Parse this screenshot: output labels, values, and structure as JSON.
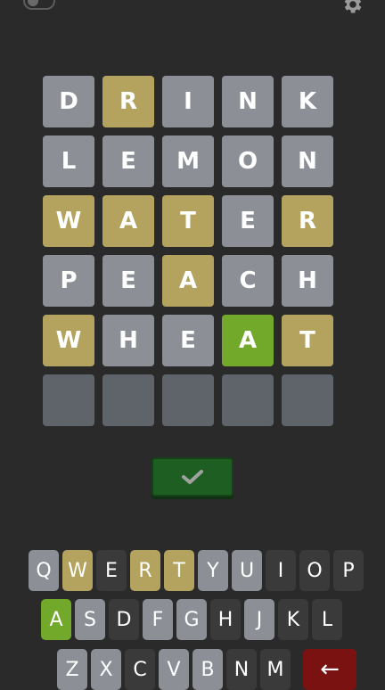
{
  "board": {
    "rows": [
      [
        {
          "letter": "D",
          "state": "gray"
        },
        {
          "letter": "R",
          "state": "yellow"
        },
        {
          "letter": "I",
          "state": "gray"
        },
        {
          "letter": "N",
          "state": "gray"
        },
        {
          "letter": "K",
          "state": "gray"
        }
      ],
      [
        {
          "letter": "L",
          "state": "gray"
        },
        {
          "letter": "E",
          "state": "gray"
        },
        {
          "letter": "M",
          "state": "gray"
        },
        {
          "letter": "O",
          "state": "gray"
        },
        {
          "letter": "N",
          "state": "gray"
        }
      ],
      [
        {
          "letter": "W",
          "state": "yellow"
        },
        {
          "letter": "A",
          "state": "yellow"
        },
        {
          "letter": "T",
          "state": "yellow"
        },
        {
          "letter": "E",
          "state": "gray"
        },
        {
          "letter": "R",
          "state": "yellow"
        }
      ],
      [
        {
          "letter": "P",
          "state": "gray"
        },
        {
          "letter": "E",
          "state": "gray"
        },
        {
          "letter": "A",
          "state": "yellow"
        },
        {
          "letter": "C",
          "state": "gray"
        },
        {
          "letter": "H",
          "state": "gray"
        }
      ],
      [
        {
          "letter": "W",
          "state": "yellow"
        },
        {
          "letter": "H",
          "state": "gray"
        },
        {
          "letter": "E",
          "state": "gray"
        },
        {
          "letter": "A",
          "state": "green"
        },
        {
          "letter": "T",
          "state": "yellow"
        }
      ],
      [
        {
          "letter": "",
          "state": "empty"
        },
        {
          "letter": "",
          "state": "empty"
        },
        {
          "letter": "",
          "state": "empty"
        },
        {
          "letter": "",
          "state": "empty"
        },
        {
          "letter": "",
          "state": "empty"
        }
      ]
    ]
  },
  "keyboard": {
    "rows": [
      [
        {
          "k": "Q",
          "s": "gray"
        },
        {
          "k": "W",
          "s": "yellow"
        },
        {
          "k": "E",
          "s": "dark"
        },
        {
          "k": "R",
          "s": "yellow"
        },
        {
          "k": "T",
          "s": "yellow"
        },
        {
          "k": "Y",
          "s": "gray"
        },
        {
          "k": "U",
          "s": "gray"
        },
        {
          "k": "I",
          "s": "dark"
        },
        {
          "k": "O",
          "s": "dark"
        },
        {
          "k": "P",
          "s": "dark"
        }
      ],
      [
        {
          "k": "A",
          "s": "green"
        },
        {
          "k": "S",
          "s": "gray"
        },
        {
          "k": "D",
          "s": "dark"
        },
        {
          "k": "F",
          "s": "gray"
        },
        {
          "k": "G",
          "s": "gray"
        },
        {
          "k": "H",
          "s": "dark"
        },
        {
          "k": "J",
          "s": "gray"
        },
        {
          "k": "K",
          "s": "dark"
        },
        {
          "k": "L",
          "s": "dark"
        }
      ],
      [
        {
          "k": "Z",
          "s": "gray"
        },
        {
          "k": "X",
          "s": "gray"
        },
        {
          "k": "C",
          "s": "dark"
        },
        {
          "k": "V",
          "s": "gray"
        },
        {
          "k": "B",
          "s": "gray"
        },
        {
          "k": "N",
          "s": "dark"
        },
        {
          "k": "M",
          "s": "dark"
        },
        {
          "k": "←",
          "s": "back"
        }
      ]
    ]
  },
  "icons": {
    "settings": "gear-icon",
    "submit": "checkmark-icon",
    "toggle": "toggle-switch"
  },
  "colors": {
    "background": "#2a2a2a",
    "tile_gray": "#8c9096",
    "tile_yellow": "#b3a35e",
    "tile_green": "#72a92a",
    "tile_empty": "#5f636a",
    "submit": "#1f5e22",
    "backspace": "#7a1212"
  }
}
